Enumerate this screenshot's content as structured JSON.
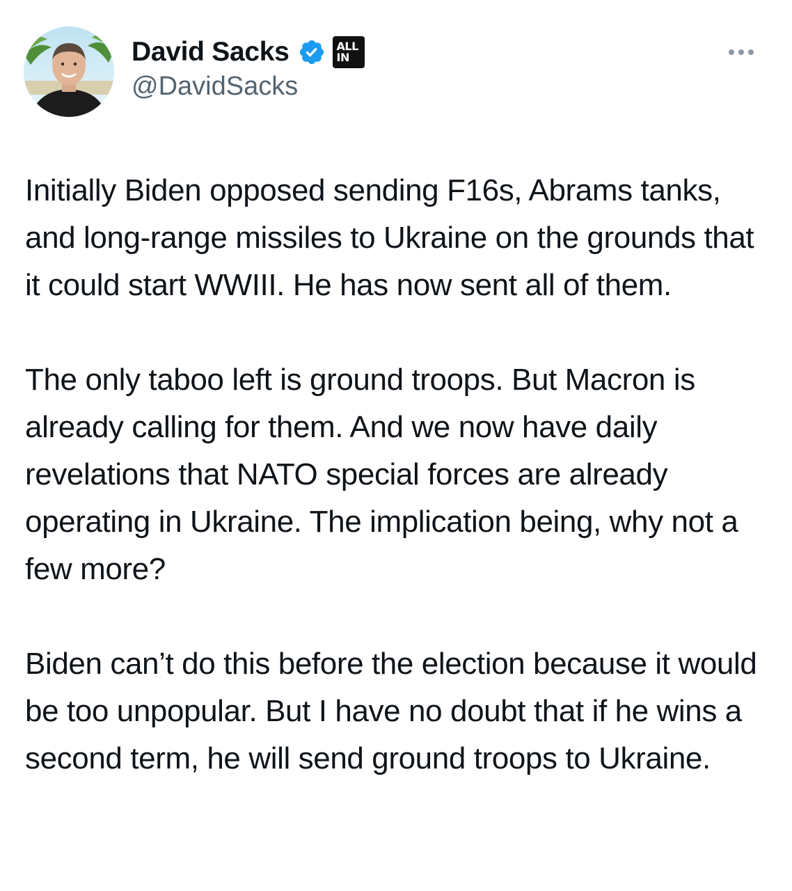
{
  "author": {
    "display_name": "David Sacks",
    "handle": "@DavidSacks",
    "verified": true,
    "affiliate_badge": {
      "line1": "ALL",
      "line2": "IN"
    },
    "verified_color": "#1d9bf0"
  },
  "menu": {
    "icon": "more-horizontal-icon"
  },
  "tweet": {
    "paragraphs": [
      "Initially Biden opposed sending F16s, Abrams tanks, and long-range missiles to Ukraine on the grounds that it could start WWIII. He has now sent all of them.",
      "The only taboo left is ground troops. But Macron is already calling for them. And we now have daily revelations that NATO special forces are already operating in Ukraine. The implication being, why not a few more?",
      "Biden can’t do this before the election because it would be too unpopular. But I have no doubt that if he wins a second term, he will send ground troops to Ukraine."
    ]
  }
}
